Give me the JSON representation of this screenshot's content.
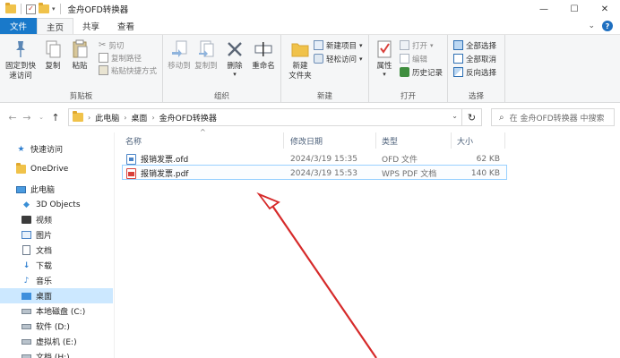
{
  "window": {
    "title": "金舟OFD转换器",
    "controls": [
      "—",
      "☐",
      "✕"
    ]
  },
  "tabs": [
    {
      "label": "文件",
      "kind": "file"
    },
    {
      "label": "主页",
      "kind": "active"
    },
    {
      "label": "共享",
      "kind": "normal"
    },
    {
      "label": "查看",
      "kind": "normal"
    }
  ],
  "ribbon": {
    "clipboard": {
      "label": "剪贴板",
      "pin": "固定到快\n速访问",
      "copy": "复制",
      "paste": "粘贴",
      "cut": "剪切",
      "copy_path": "复制路径",
      "paste_shortcut": "粘贴快捷方式"
    },
    "organize": {
      "label": "组织",
      "move_to": "移动到",
      "copy_to": "复制到",
      "delete": "删除",
      "rename": "重命名"
    },
    "new": {
      "label": "新建",
      "new_folder": "新建\n文件夹",
      "new_item": "新建项目",
      "easy_access": "轻松访问"
    },
    "open": {
      "label": "打开",
      "properties": "属性",
      "open": "打开",
      "edit": "编辑",
      "history": "历史记录"
    },
    "select": {
      "label": "选择",
      "select_all": "全部选择",
      "select_none": "全部取消",
      "invert": "反向选择"
    }
  },
  "address": {
    "crumbs": [
      "此电脑",
      "桌面",
      "金舟OFD转换器"
    ],
    "search_placeholder": "在 金舟OFD转换器 中搜索"
  },
  "nav": [
    {
      "label": "快速访问",
      "icon": "star-icon",
      "level": 0
    },
    {
      "label": "OneDrive",
      "icon": "onedrive-icon",
      "level": 0
    },
    {
      "label": "此电脑",
      "icon": "computer-icon",
      "level": 0
    },
    {
      "label": "3D Objects",
      "icon": "3d-objects-icon",
      "level": 1
    },
    {
      "label": "视频",
      "icon": "video-icon",
      "level": 1
    },
    {
      "label": "图片",
      "icon": "picture-icon",
      "level": 1
    },
    {
      "label": "文档",
      "icon": "document-icon",
      "level": 1
    },
    {
      "label": "下载",
      "icon": "download-icon",
      "level": 1
    },
    {
      "label": "音乐",
      "icon": "music-icon",
      "level": 1
    },
    {
      "label": "桌面",
      "icon": "desktop-icon",
      "level": 1,
      "selected": true
    },
    {
      "label": "本地磁盘 (C:)",
      "icon": "drive-icon",
      "level": 1
    },
    {
      "label": "软件 (D:)",
      "icon": "drive-icon",
      "level": 1
    },
    {
      "label": "虚拟机 (E:)",
      "icon": "drive-icon",
      "level": 1
    },
    {
      "label": "文档 (H:)",
      "icon": "drive-icon",
      "level": 1
    }
  ],
  "columns": {
    "name": "名称",
    "date": "修改日期",
    "type": "类型",
    "size": "大小"
  },
  "files": [
    {
      "name": "报销发票.ofd",
      "date": "2024/3/19 15:35",
      "type": "OFD 文件",
      "size": "62 KB",
      "icon": "ofd-file-icon"
    },
    {
      "name": "报销发票.pdf",
      "date": "2024/3/19 15:53",
      "type": "WPS PDF 文档",
      "size": "140 KB",
      "icon": "pdf-file-icon",
      "selected": true
    }
  ],
  "colors": {
    "accent": "#1979ca",
    "selection": "#cce8ff",
    "annotation_arrow": "#d62a2a"
  }
}
